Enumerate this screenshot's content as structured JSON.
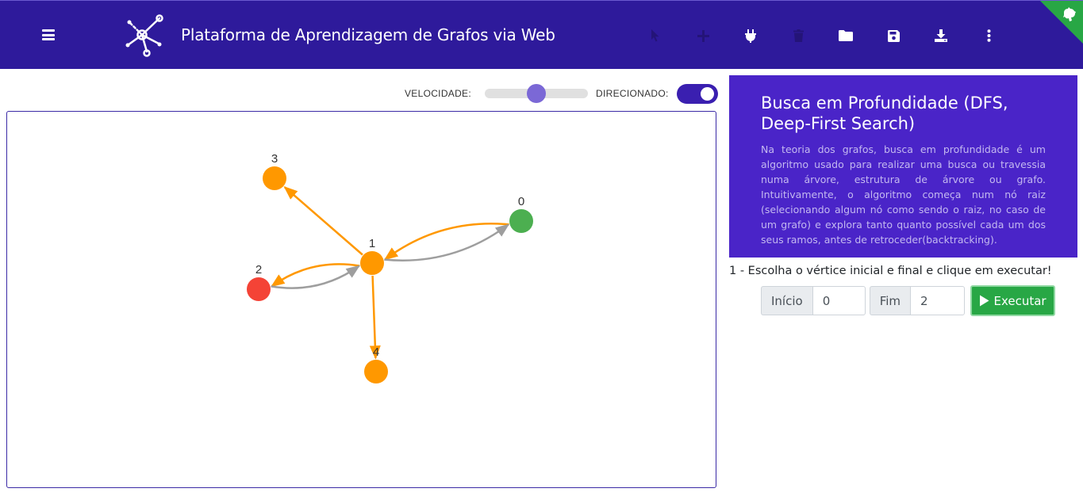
{
  "header": {
    "title": "Plataforma de Aprendizagem de Grafos via Web",
    "background": "#2e1a9b",
    "menu_icon": "hamburger-menu-icon",
    "logo_icon": "graph-logo-icon",
    "toolbar": [
      {
        "name": "select-tool-button",
        "icon": "cursor-icon",
        "enabled": false
      },
      {
        "name": "add-vertex-button",
        "icon": "plus-icon",
        "enabled": false
      },
      {
        "name": "connect-edge-button",
        "icon": "plug-icon",
        "enabled": true
      },
      {
        "name": "delete-button",
        "icon": "trash-icon",
        "enabled": false
      },
      {
        "name": "open-button",
        "icon": "folder-icon",
        "enabled": true
      },
      {
        "name": "save-button",
        "icon": "save-icon",
        "enabled": true
      },
      {
        "name": "download-button",
        "icon": "download-icon",
        "enabled": true
      },
      {
        "name": "more-options-button",
        "icon": "more-vertical-icon",
        "enabled": true
      }
    ],
    "corner_badge_icon": "github-icon"
  },
  "controls": {
    "speed_label": "VELOCIDADE:",
    "speed_value": 0.5,
    "directed_label": "DIRECIONADO:",
    "directed": true
  },
  "graph": {
    "vertices": [
      {
        "id": "0",
        "color": "#4caf50"
      },
      {
        "id": "1",
        "color": "#ff9800"
      },
      {
        "id": "2",
        "color": "#f44336"
      },
      {
        "id": "3",
        "color": "#ff9800"
      },
      {
        "id": "4",
        "color": "#ff9800"
      }
    ],
    "edges": [
      {
        "from": "0",
        "to": "1",
        "color": "#ff9800"
      },
      {
        "from": "1",
        "to": "0",
        "color": "#9e9e9e"
      },
      {
        "from": "1",
        "to": "2",
        "color": "#ff9800"
      },
      {
        "from": "2",
        "to": "1",
        "color": "#9e9e9e"
      },
      {
        "from": "1",
        "to": "3",
        "color": "#ff9800"
      },
      {
        "from": "1",
        "to": "4",
        "color": "#ff9800"
      }
    ]
  },
  "algorithm": {
    "title": "Busca em Profundidade (DFS, Deep-First Search)",
    "description": "Na teoria dos grafos, busca em profundidade é um algoritmo usado para realizar uma busca ou travessia numa árvore, estrutura de árvore ou grafo. Intuitivamente, o algoritmo começa num nó raiz (selecionando algum nó como sendo o raiz, no caso de um grafo) e explora tanto quanto possível cada um dos seus ramos, antes de retroceder(backtracking)."
  },
  "run": {
    "instruction": "1 - Escolha o vértice inicial e final e clique em executar!",
    "start_label": "Início",
    "start_value": "0",
    "end_label": "Fim",
    "end_value": "2",
    "execute_label": "Executar",
    "execute_icon": "play-icon"
  }
}
